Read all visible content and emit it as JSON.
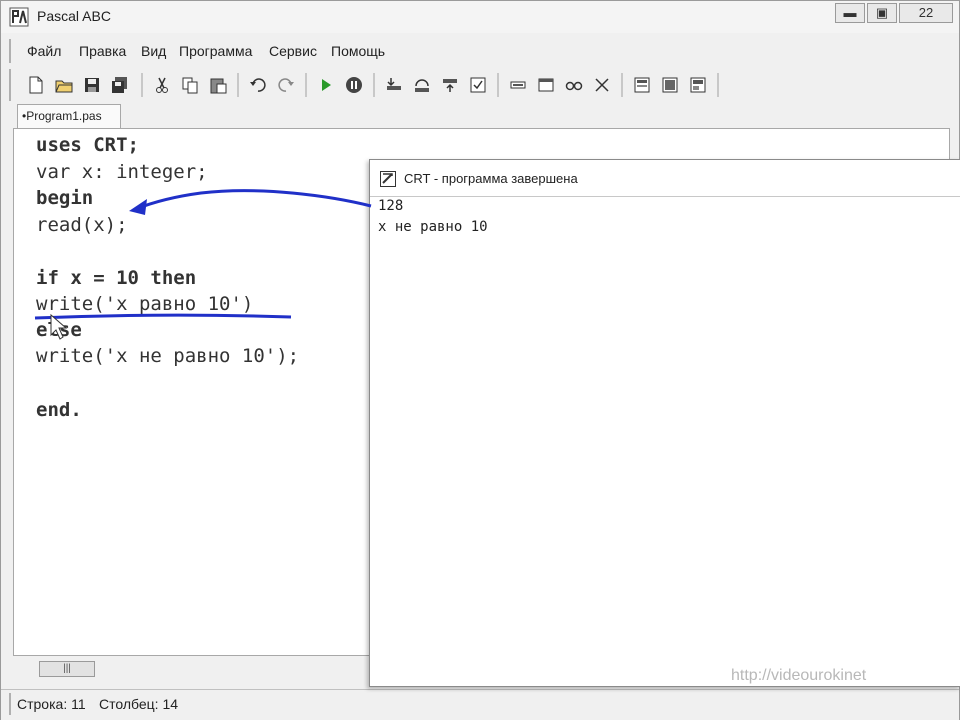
{
  "window": {
    "title": "Pascal ABC",
    "minimize_label": "▬",
    "maximize_label": "▣",
    "close_label": "22"
  },
  "menu": [
    "Файл",
    "Правка",
    "Вид",
    "Программа",
    "Сервис",
    "Помощь"
  ],
  "toolbar": {
    "icons": [
      "new-file-icon",
      "open-file-icon",
      "save-icon",
      "save-all-icon",
      "cut-icon",
      "copy-icon",
      "paste-icon",
      "undo-icon",
      "redo-icon",
      "run-icon",
      "stop-icon",
      "step-into-icon",
      "step-over-icon",
      "step-out-icon",
      "watch-icon",
      "breakpoint-icon",
      "window-icon",
      "glasses-icon",
      "close-x-icon",
      "compile-icon",
      "compile-all-icon",
      "run-compiled-icon"
    ]
  },
  "tab": {
    "label": "•Program1.pas"
  },
  "editor": {
    "lines": [
      {
        "text": "uses CRT;",
        "bold": true
      },
      {
        "text": "var x: integer;",
        "bold": false
      },
      {
        "text": "begin",
        "bold": true
      },
      {
        "text": "read(x);",
        "bold": false
      },
      {
        "text": "",
        "bold": false
      },
      {
        "text": "if x = 10 then",
        "bold": true
      },
      {
        "text": "write('x равно 10')",
        "bold": false
      },
      {
        "text": "else",
        "bold": true
      },
      {
        "text": "write('x не равно 10');",
        "bold": false
      },
      {
        "text": "",
        "bold": false
      },
      {
        "text": "end.",
        "bold": true
      }
    ]
  },
  "crt_window": {
    "title": "CRT - программа завершена",
    "output": [
      "128",
      "x не равно 10"
    ]
  },
  "status": {
    "line_label": "Строка: 11",
    "column_label": "Столбец: 14"
  },
  "watermark": "http://videourokinet",
  "annotation_color": "#2030c8"
}
